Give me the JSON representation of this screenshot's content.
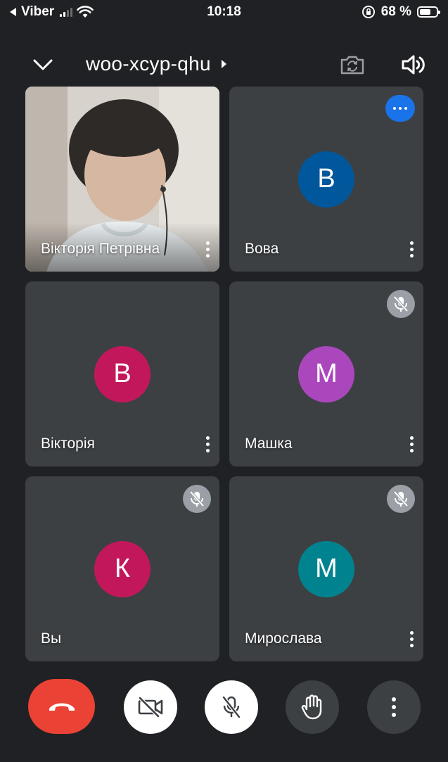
{
  "status_bar": {
    "back_app": "Viber",
    "time": "10:18",
    "battery_percent": "68 %",
    "battery_level": 0.68
  },
  "header": {
    "meeting_code": "woo-xcyp-qhu"
  },
  "participants": [
    {
      "name": "Вікторія Петрівна",
      "initial": "",
      "avatar_color": "",
      "has_video": true,
      "muted": false,
      "options_badge": false
    },
    {
      "name": "Вова",
      "initial": "В",
      "avatar_color": "#01579b",
      "has_video": false,
      "muted": false,
      "options_badge": true
    },
    {
      "name": "Вікторія",
      "initial": "В",
      "avatar_color": "#c2185b",
      "has_video": false,
      "muted": false,
      "options_badge": false
    },
    {
      "name": "Машка",
      "initial": "М",
      "avatar_color": "#ab47bc",
      "has_video": false,
      "muted": true,
      "options_badge": false
    },
    {
      "name": "Вы",
      "initial": "К",
      "avatar_color": "#c2185b",
      "has_video": false,
      "muted": true,
      "options_badge": false
    },
    {
      "name": "Мирослава",
      "initial": "М",
      "avatar_color": "#00838f",
      "has_video": false,
      "muted": true,
      "options_badge": false
    }
  ],
  "controls": {
    "end_call_color": "#ea4335",
    "items": [
      "end-call-icon",
      "camera-off-icon",
      "mic-off-icon",
      "raise-hand-icon",
      "more-vert-icon"
    ]
  },
  "colors": {
    "background": "#202124",
    "tile": "#3c4043",
    "mute_badge": "#9aa0a6",
    "accent": "#1a73e8"
  }
}
